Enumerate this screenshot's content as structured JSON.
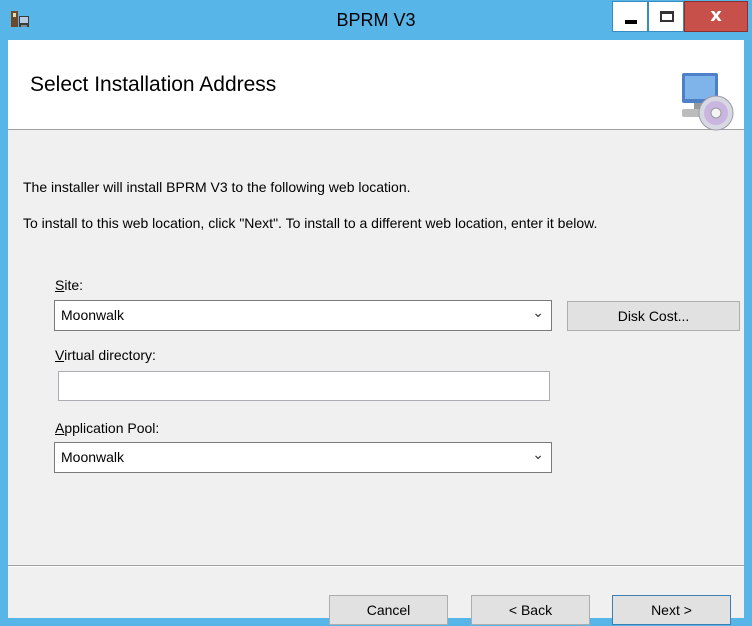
{
  "window": {
    "title": "BPRM V3",
    "icons": {
      "app": "installer-icon",
      "minimize": "minimize-icon",
      "maximize": "maximize-icon",
      "close": "close-icon"
    },
    "close_glyph": "x",
    "colors": {
      "titlebar": "#57b5e8",
      "close": "#c7504b",
      "body": "#f0f0f0"
    }
  },
  "banner": {
    "title": "Select Installation Address",
    "icon": "computer-disc-icon"
  },
  "body": {
    "intro": "The installer will install BPRM V3 to the following web location.",
    "instructions": "To install to this web location, click \"Next\". To install to a different web location, enter it below."
  },
  "site": {
    "label_mnemonic": "S",
    "label_rest": "ite:",
    "value": "Moonwalk"
  },
  "disk_cost": {
    "label": "Disk Cost..."
  },
  "virtual_directory": {
    "label_mnemonic": "V",
    "label_rest": "irtual directory:",
    "value": ""
  },
  "app_pool": {
    "label_mnemonic": "A",
    "label_rest": "pplication Pool:",
    "value": "Moonwalk"
  },
  "footer": {
    "cancel": "Cancel",
    "back": "< Back",
    "next": "Next >"
  }
}
